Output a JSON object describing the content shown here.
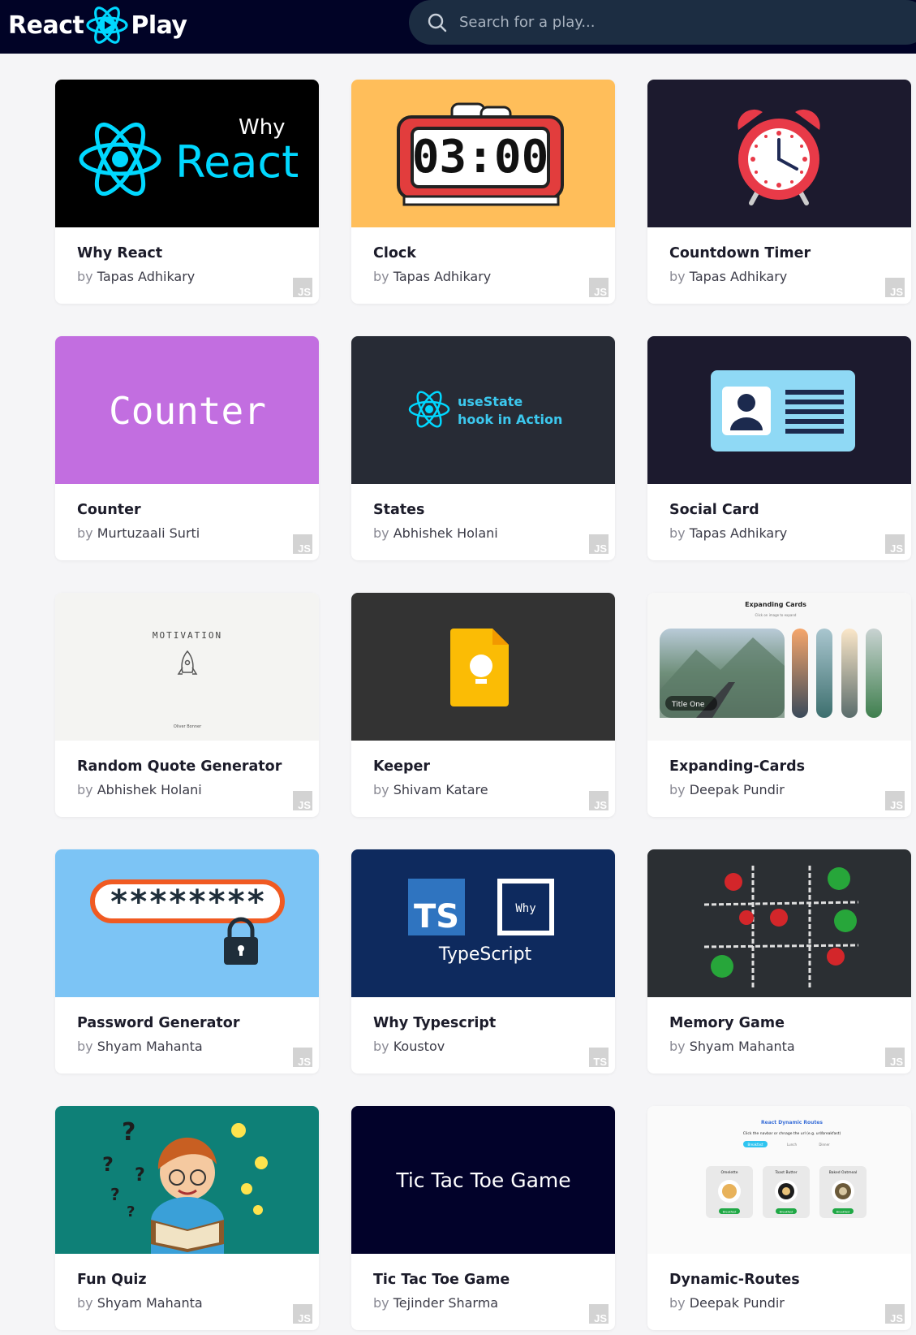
{
  "header": {
    "logo_left": "React",
    "logo_right": "Play",
    "search_placeholder": "Search for a play..."
  },
  "plays": [
    {
      "title": "Why React",
      "by": "by",
      "author": "Tapas Adhikary",
      "lang": "JS",
      "thumb_texts": [
        "Why",
        "React"
      ]
    },
    {
      "title": "Clock",
      "by": "by",
      "author": "Tapas Adhikary",
      "lang": "JS",
      "thumb_texts": [
        "03:00"
      ]
    },
    {
      "title": "Countdown Timer",
      "by": "by",
      "author": "Tapas Adhikary",
      "lang": "JS",
      "thumb_texts": []
    },
    {
      "title": "Counter",
      "by": "by",
      "author": "Murtuzaali Surti",
      "lang": "JS",
      "thumb_texts": [
        "Counter"
      ]
    },
    {
      "title": "States",
      "by": "by",
      "author": "Abhishek Holani",
      "lang": "JS",
      "thumb_texts": [
        "useState",
        "hook in Action"
      ]
    },
    {
      "title": "Social Card",
      "by": "by",
      "author": "Tapas Adhikary",
      "lang": "JS",
      "thumb_texts": []
    },
    {
      "title": "Random Quote Generator",
      "by": "by",
      "author": "Abhishek Holani",
      "lang": "JS",
      "thumb_texts": [
        "MOTIVATION",
        "Oliver Bonner"
      ]
    },
    {
      "title": "Keeper",
      "by": "by",
      "author": "Shivam Katare",
      "lang": "JS",
      "thumb_texts": []
    },
    {
      "title": "Expanding-Cards",
      "by": "by",
      "author": "Deepak Pundir",
      "lang": "JS",
      "thumb_texts": [
        "Expanding Cards",
        "Click on image to expand",
        "Title One"
      ]
    },
    {
      "title": "Password Generator",
      "by": "by",
      "author": "Shyam Mahanta",
      "lang": "JS",
      "thumb_texts": [
        "********"
      ]
    },
    {
      "title": "Why Typescript",
      "by": "by",
      "author": "Koustov",
      "lang": "TS",
      "thumb_texts": [
        "TS",
        "Why",
        "TypeScript"
      ]
    },
    {
      "title": "Memory Game",
      "by": "by",
      "author": "Shyam Mahanta",
      "lang": "JS",
      "thumb_texts": []
    },
    {
      "title": "Fun Quiz",
      "by": "by",
      "author": "Shyam Mahanta",
      "lang": "JS",
      "thumb_texts": []
    },
    {
      "title": "Tic Tac Toe Game",
      "by": "by",
      "author": "Tejinder Sharma",
      "lang": "JS",
      "thumb_texts": [
        "Tic Tac Toe Game"
      ]
    },
    {
      "title": "Dynamic-Routes",
      "by": "by",
      "author": "Deepak Pundir",
      "lang": "JS",
      "thumb_texts": [
        "React Dynamic Routes",
        "Click the navbar or chnage the url (e.g. url/breakfast)",
        "Breakfast",
        "Lunch",
        "Dinner",
        "Omelette",
        "Toast Butter",
        "Baked Oatmeal"
      ]
    }
  ],
  "colors": {
    "header_bg": "#010326",
    "search_bg": "#1c2d42",
    "react_cyan": "#00d8ff",
    "page_bg": "#f5f5f7"
  },
  "icons": {
    "logo": "react-atom-play-icon",
    "search": "search-icon"
  }
}
